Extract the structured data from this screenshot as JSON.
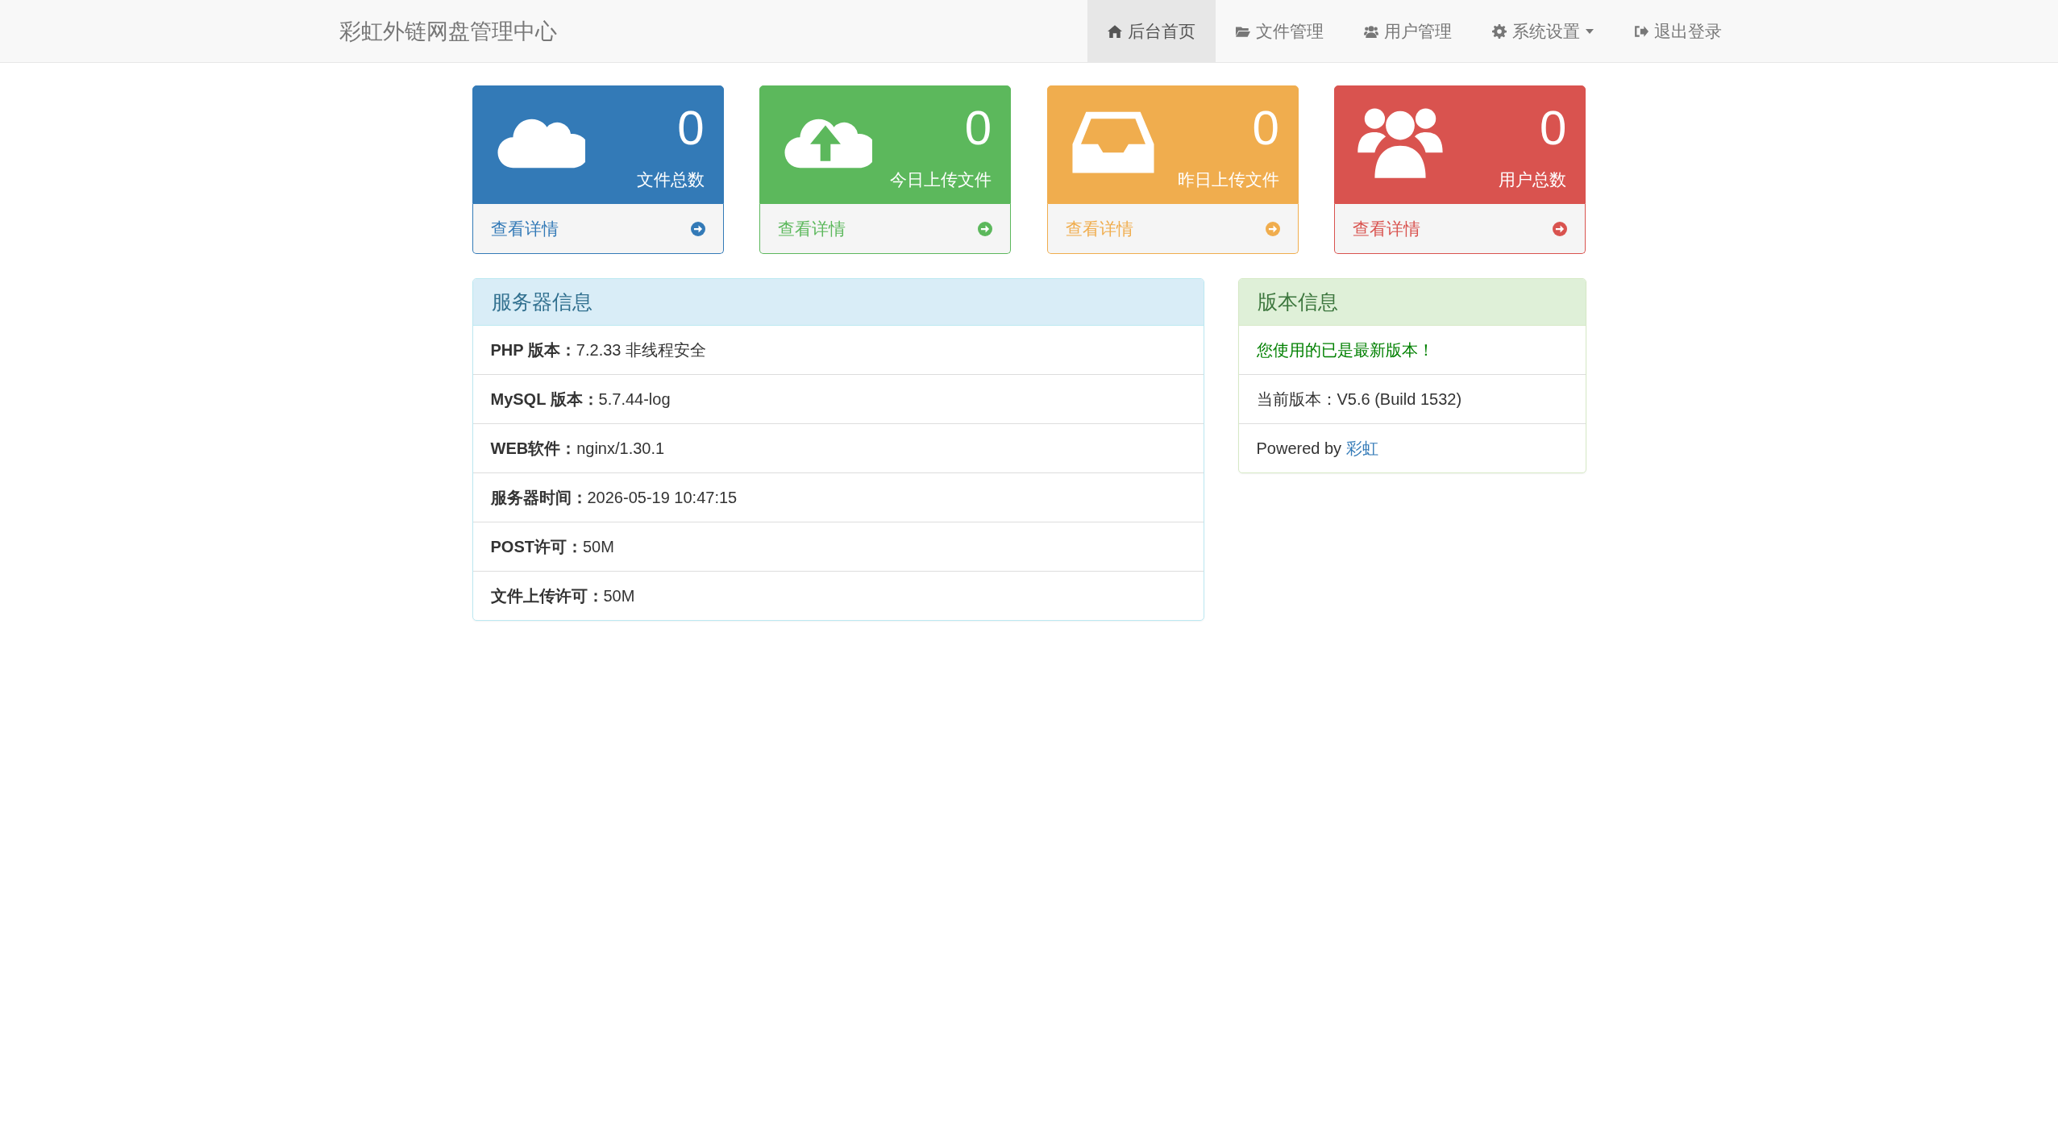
{
  "navbar": {
    "brand": "彩虹外链网盘管理中心",
    "items": [
      {
        "kind": "home",
        "label": "后台首页",
        "selected": true,
        "dropdown": false
      },
      {
        "kind": "folder",
        "label": "文件管理",
        "selected": false,
        "dropdown": false
      },
      {
        "kind": "users",
        "label": "用户管理",
        "selected": false,
        "dropdown": false
      },
      {
        "kind": "gear",
        "label": "系统设置",
        "selected": false,
        "dropdown": true
      },
      {
        "kind": "logout",
        "label": "退出登录",
        "selected": false,
        "dropdown": false
      }
    ]
  },
  "cards": [
    {
      "kind": "cloud",
      "color": "#337ab7",
      "count": "0",
      "label": "文件总数",
      "link": "查看详情"
    },
    {
      "kind": "upload",
      "color": "#5cb85c",
      "count": "0",
      "label": "今日上传文件",
      "link": "查看详情"
    },
    {
      "kind": "inbox",
      "color": "#f0ad4e",
      "count": "0",
      "label": "昨日上传文件",
      "link": "查看详情"
    },
    {
      "kind": "users",
      "color": "#d9534f",
      "count": "0",
      "label": "用户总数",
      "link": "查看详情"
    }
  ],
  "server_panel": {
    "title": "服务器信息",
    "rows": [
      "**PHP 版本：**7.2.33 非线程安全",
      "**MySQL 版本：**5.7.44-log",
      "**WEB软件：**nginx/1.30.1",
      "**服务器时间：**2026-05-19 10:47:15",
      "**POST许可：**50M",
      "**文件上传许可：**50M"
    ]
  },
  "version_panel": {
    "title": "版本信息",
    "rows": [
      {
        "kind": "notice",
        "text": "您使用的已是最新版本！"
      },
      {
        "kind": "plain",
        "text": "当前版本：V5.6 (Build 1532)"
      },
      {
        "kind": "credit",
        "text": "Powered by ",
        "link": "彩虹"
      }
    ]
  }
}
